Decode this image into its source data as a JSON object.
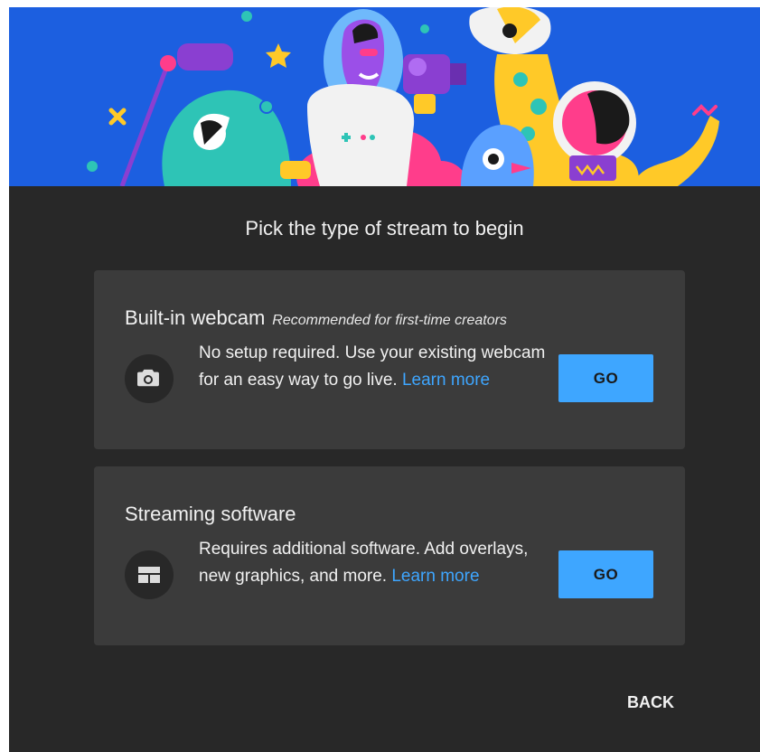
{
  "dialog": {
    "title": "Pick the type of stream to begin",
    "back_label": "BACK"
  },
  "hero": {
    "illustration": "creators-illustration",
    "background": "#1c5fe0"
  },
  "options": [
    {
      "title": "Built-in webcam",
      "tag": "Recommended for first-time creators",
      "description": "No setup required. Use your existing webcam for an easy way to go live.",
      "learn_more": "Learn more",
      "button": "GO",
      "icon": "camera-icon"
    },
    {
      "title": "Streaming software",
      "tag": "",
      "description": "Requires additional software. Add overlays, new graphics, and more.",
      "learn_more": "Learn more",
      "button": "GO",
      "icon": "layout-icon"
    }
  ],
  "colors": {
    "accent": "#3ea6ff",
    "dialog_bg": "#282828",
    "card_bg": "#3b3b3b",
    "text": "#f1f1f1"
  }
}
